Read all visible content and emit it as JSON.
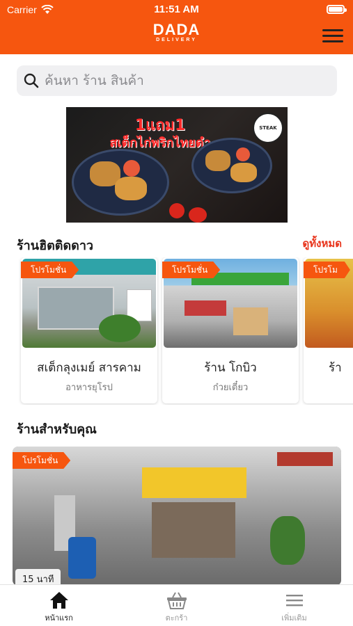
{
  "status_bar": {
    "carrier": "Carrier",
    "time": "11:51 AM",
    "battery_level": 1.0
  },
  "header": {
    "logo_main": "DADA",
    "logo_sub": "DELIVERY",
    "menu_icon": "hamburger-icon"
  },
  "search": {
    "placeholder": "ค้นหา ร้าน สินค้า",
    "icon": "search-icon"
  },
  "banner": {
    "headline": "1แถม1",
    "subline": "สเต็กไก่พริกไทยดำ",
    "badge": "STEAK"
  },
  "hot_section": {
    "title": "ร้านฮิตติดดาว",
    "see_all": "ดูทั้งหมด",
    "stores": [
      {
        "promo": "โปรโมชั่น",
        "name": "สเต็กลุงเมย์ สารคาม",
        "category": "อาหารยุโรป"
      },
      {
        "promo": "โปรโมชั่น",
        "name": "ร้าน โกบิว",
        "category": "ก๋วยเตี๋ยว"
      },
      {
        "promo": "โปรโม",
        "name": "ร้า",
        "category": ""
      }
    ]
  },
  "for_you_section": {
    "title": "ร้านสำหรับคุณ",
    "card": {
      "promo": "โปรโมชั่น",
      "time": "15 นาที"
    }
  },
  "tabbar": {
    "tabs": [
      {
        "label": "หน้าแรก",
        "icon": "home-icon",
        "active": true
      },
      {
        "label": "ตะกร้า",
        "icon": "basket-icon",
        "active": false
      },
      {
        "label": "เพิ่มเติม",
        "icon": "menu-lines-icon",
        "active": false
      }
    ]
  },
  "colors": {
    "brand": "#f6560f",
    "link": "#e8341c"
  }
}
